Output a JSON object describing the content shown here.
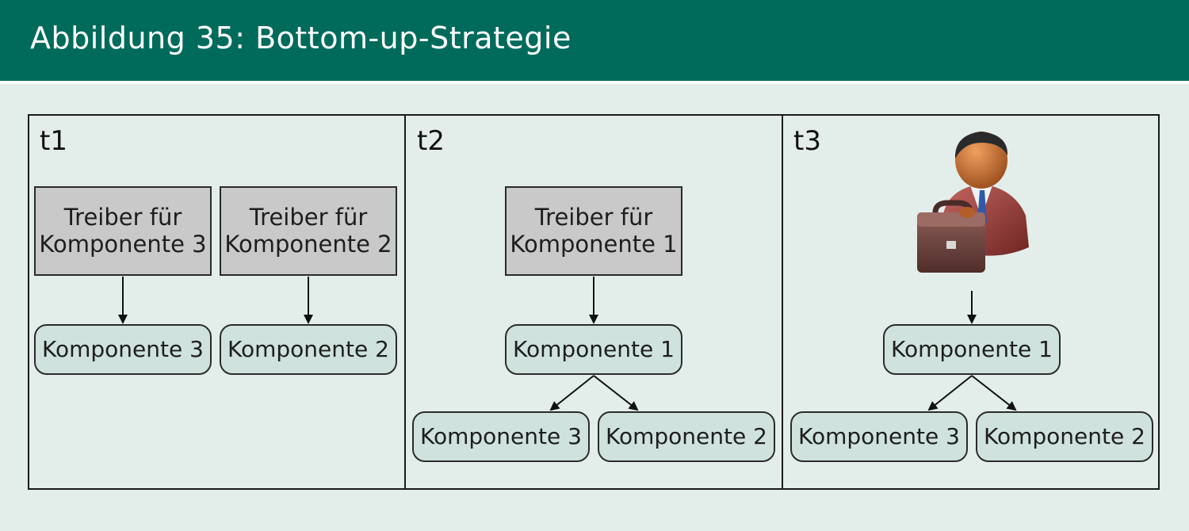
{
  "header": {
    "title": "Abbildung 35: Bottom-up-Strategie"
  },
  "colors": {
    "header_bg": "#006b5b",
    "page_bg": "#e3eeeb",
    "driver_fill": "#c9c9c9",
    "component_fill": "#cfe2de"
  },
  "panels": [
    {
      "label": "t1",
      "drivers": [
        {
          "line1": "Treiber für",
          "line2": "Komponente 3"
        },
        {
          "line1": "Treiber für",
          "line2": "Komponente 2"
        }
      ],
      "components": [
        "Komponente 3",
        "Komponente 2"
      ]
    },
    {
      "label": "t2",
      "driver": {
        "line1": "Treiber für",
        "line2": "Komponente 1"
      },
      "top_component": "Komponente 1",
      "sub_components": [
        "Komponente 3",
        "Komponente 2"
      ]
    },
    {
      "label": "t3",
      "actor_icon": "businessman-with-briefcase-icon",
      "top_component": "Komponente 1",
      "sub_components": [
        "Komponente 3",
        "Komponente 2"
      ]
    }
  ]
}
